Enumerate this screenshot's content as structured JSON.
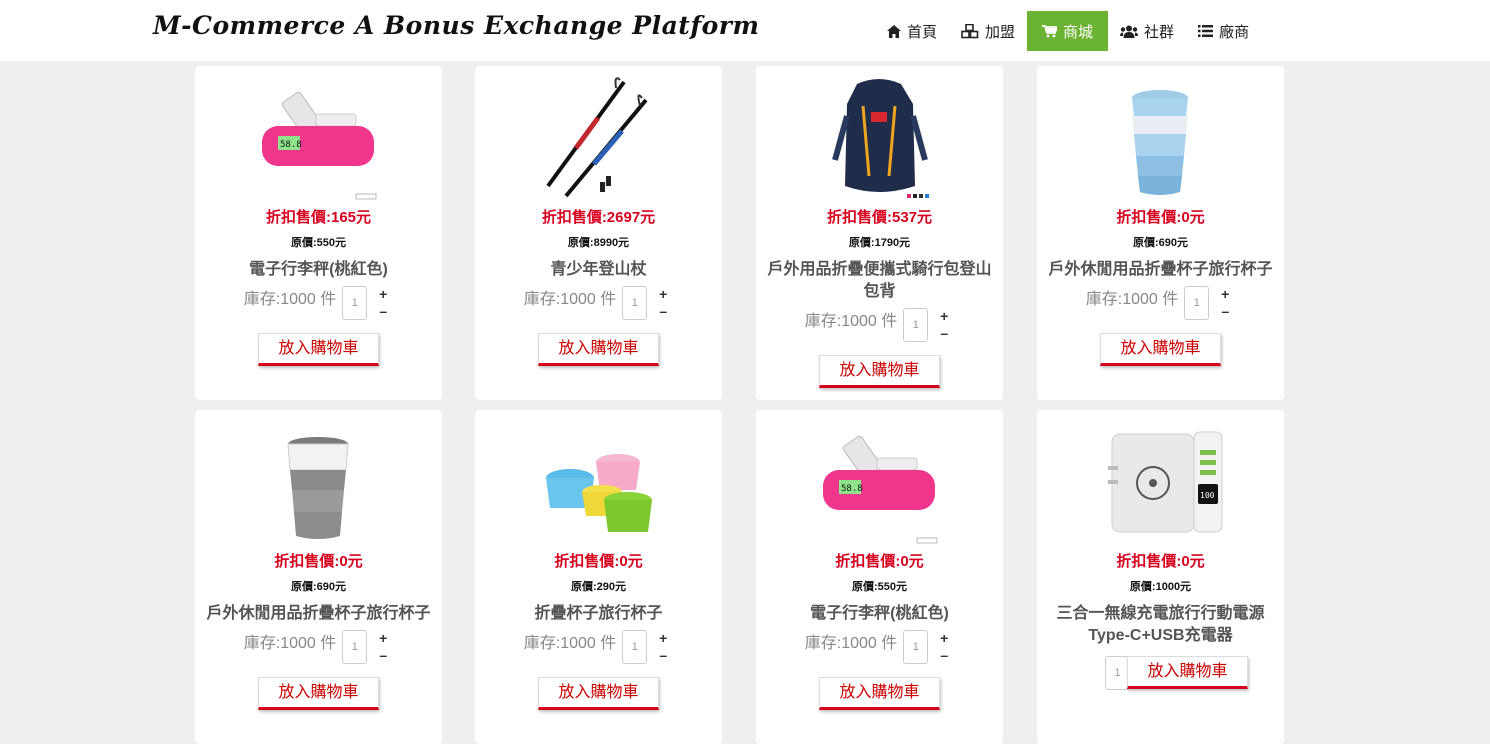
{
  "header": {
    "brand": "M-Commerce A Bonus Exchange Platform",
    "nav": [
      {
        "label": "首頁",
        "icon": "home-icon"
      },
      {
        "label": "加盟",
        "icon": "cubes-icon"
      },
      {
        "label": "商城",
        "icon": "cart-icon",
        "active": true
      },
      {
        "label": "社群",
        "icon": "users-icon"
      },
      {
        "label": "廠商",
        "icon": "list-icon"
      }
    ],
    "active_color": "#6bb332"
  },
  "products": [
    {
      "price": "折扣售價:165元",
      "orig": "原價:550元",
      "name": "電子行李秤(桃紅色)",
      "stock": "庫存:1000 件",
      "qty": "1",
      "cart": "放入購物車",
      "img": "luggage-scale"
    },
    {
      "price": "折扣售價:2697元",
      "orig": "原價:8990元",
      "name": "青少年登山杖",
      "stock": "庫存:1000 件",
      "qty": "1",
      "cart": "放入購物車",
      "img": "trekking-poles"
    },
    {
      "price": "折扣售價:537元",
      "orig": "原價:1790元",
      "name": "戶外用品折疊便攜式騎行包登山包背",
      "stock": "庫存:1000 件",
      "qty": "1",
      "cart": "放入購物車",
      "img": "backpack"
    },
    {
      "price": "折扣售價:0元",
      "orig": "原價:690元",
      "name": "戶外休閒用品折疊杯子旅行杯子",
      "stock": "庫存:1000 件",
      "qty": "1",
      "cart": "放入購物車",
      "img": "blue-cup"
    },
    {
      "price": "折扣售價:0元",
      "orig": "原價:690元",
      "name": "戶外休閒用品折疊杯子旅行杯子",
      "stock": "庫存:1000 件",
      "qty": "1",
      "cart": "放入購物車",
      "img": "gray-cup"
    },
    {
      "price": "折扣售價:0元",
      "orig": "原價:290元",
      "name": "折疊杯子旅行杯子",
      "stock": "庫存:1000 件",
      "qty": "1",
      "cart": "放入購物車",
      "img": "color-cups"
    },
    {
      "price": "折扣售價:0元",
      "orig": "原價:550元",
      "name": "電子行李秤(桃紅色)",
      "stock": "庫存:1000 件",
      "qty": "1",
      "cart": "放入購物車",
      "img": "luggage-scale"
    },
    {
      "price": "折扣售價:0元",
      "orig": "原價:1000元",
      "name": "三合一無線充電旅行行動電源 Type-C+USB充電器",
      "stock": "",
      "qty": "1",
      "cart": "放入購物車",
      "img": "power-bank"
    }
  ],
  "controls": {
    "plus": "+",
    "minus": "–"
  },
  "scale_reading": "58.8",
  "powerbank_reading": "100"
}
